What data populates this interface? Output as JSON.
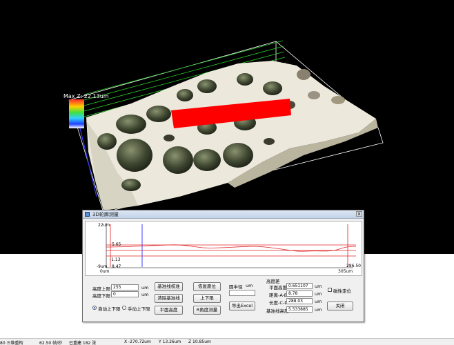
{
  "colors": {
    "profile_line": "#e02020",
    "marker_line": "#2a2aff",
    "grid_green": "#2bd02b",
    "cut_plane": "#ff0000"
  },
  "view3d": {
    "max_label": "Max Z: 22.13um"
  },
  "dialog": {
    "title": "3D轮廓测量",
    "close_glyph": "x",
    "profile": {
      "y_top": "22um",
      "y_bottom": "-9um",
      "x_left": "0um",
      "x_right": "305um",
      "ref_a": "5.65",
      "ref_b": "-1.13",
      "ref_c": "8.47",
      "right_mark": "286.50"
    },
    "upper_label": "高度上限",
    "upper_value": "255",
    "upper_unit": "um",
    "lower_label": "高度下限",
    "lower_value": "0",
    "lower_unit": "um",
    "auto_radio": "自动上下限",
    "manual_radio": "手动上下限",
    "btn_baseline_correct": "基准线校准",
    "btn_clear_baseline": "清除基准线",
    "btn_plane_height": "平面高度",
    "btn_restore_origin": "恢复原位",
    "btn_updown": "上下限",
    "btn_angle_measure": "R角度测量",
    "radius_label": "圆半径",
    "radius_unit": "um",
    "btn_export_excel": "导出Excel",
    "diff_title": "高度差",
    "plane_height_label": "平面高度",
    "plane_height_value": "0.651107",
    "plane_height_unit": "um",
    "dist_ab_label": "距离-A-B",
    "dist_ab_value": "8.78",
    "dist_ab_unit": "um",
    "len_cd_label": "长度-C-D",
    "len_cd_value": "288.03",
    "len_cd_unit": "um",
    "base_len_label": "基准线高度",
    "base_len_value": "5.533885",
    "base_len_unit": "um",
    "magnetic_label": "磁性定位",
    "btn_close": "关闭"
  },
  "statusbar": {
    "left": "80 三维重构",
    "fps": "62.50 帧/秒",
    "collected": "已重建 182 张",
    "x": "X -270.72um",
    "y": "Y 13.26um",
    "z": "Z 10.85um"
  }
}
